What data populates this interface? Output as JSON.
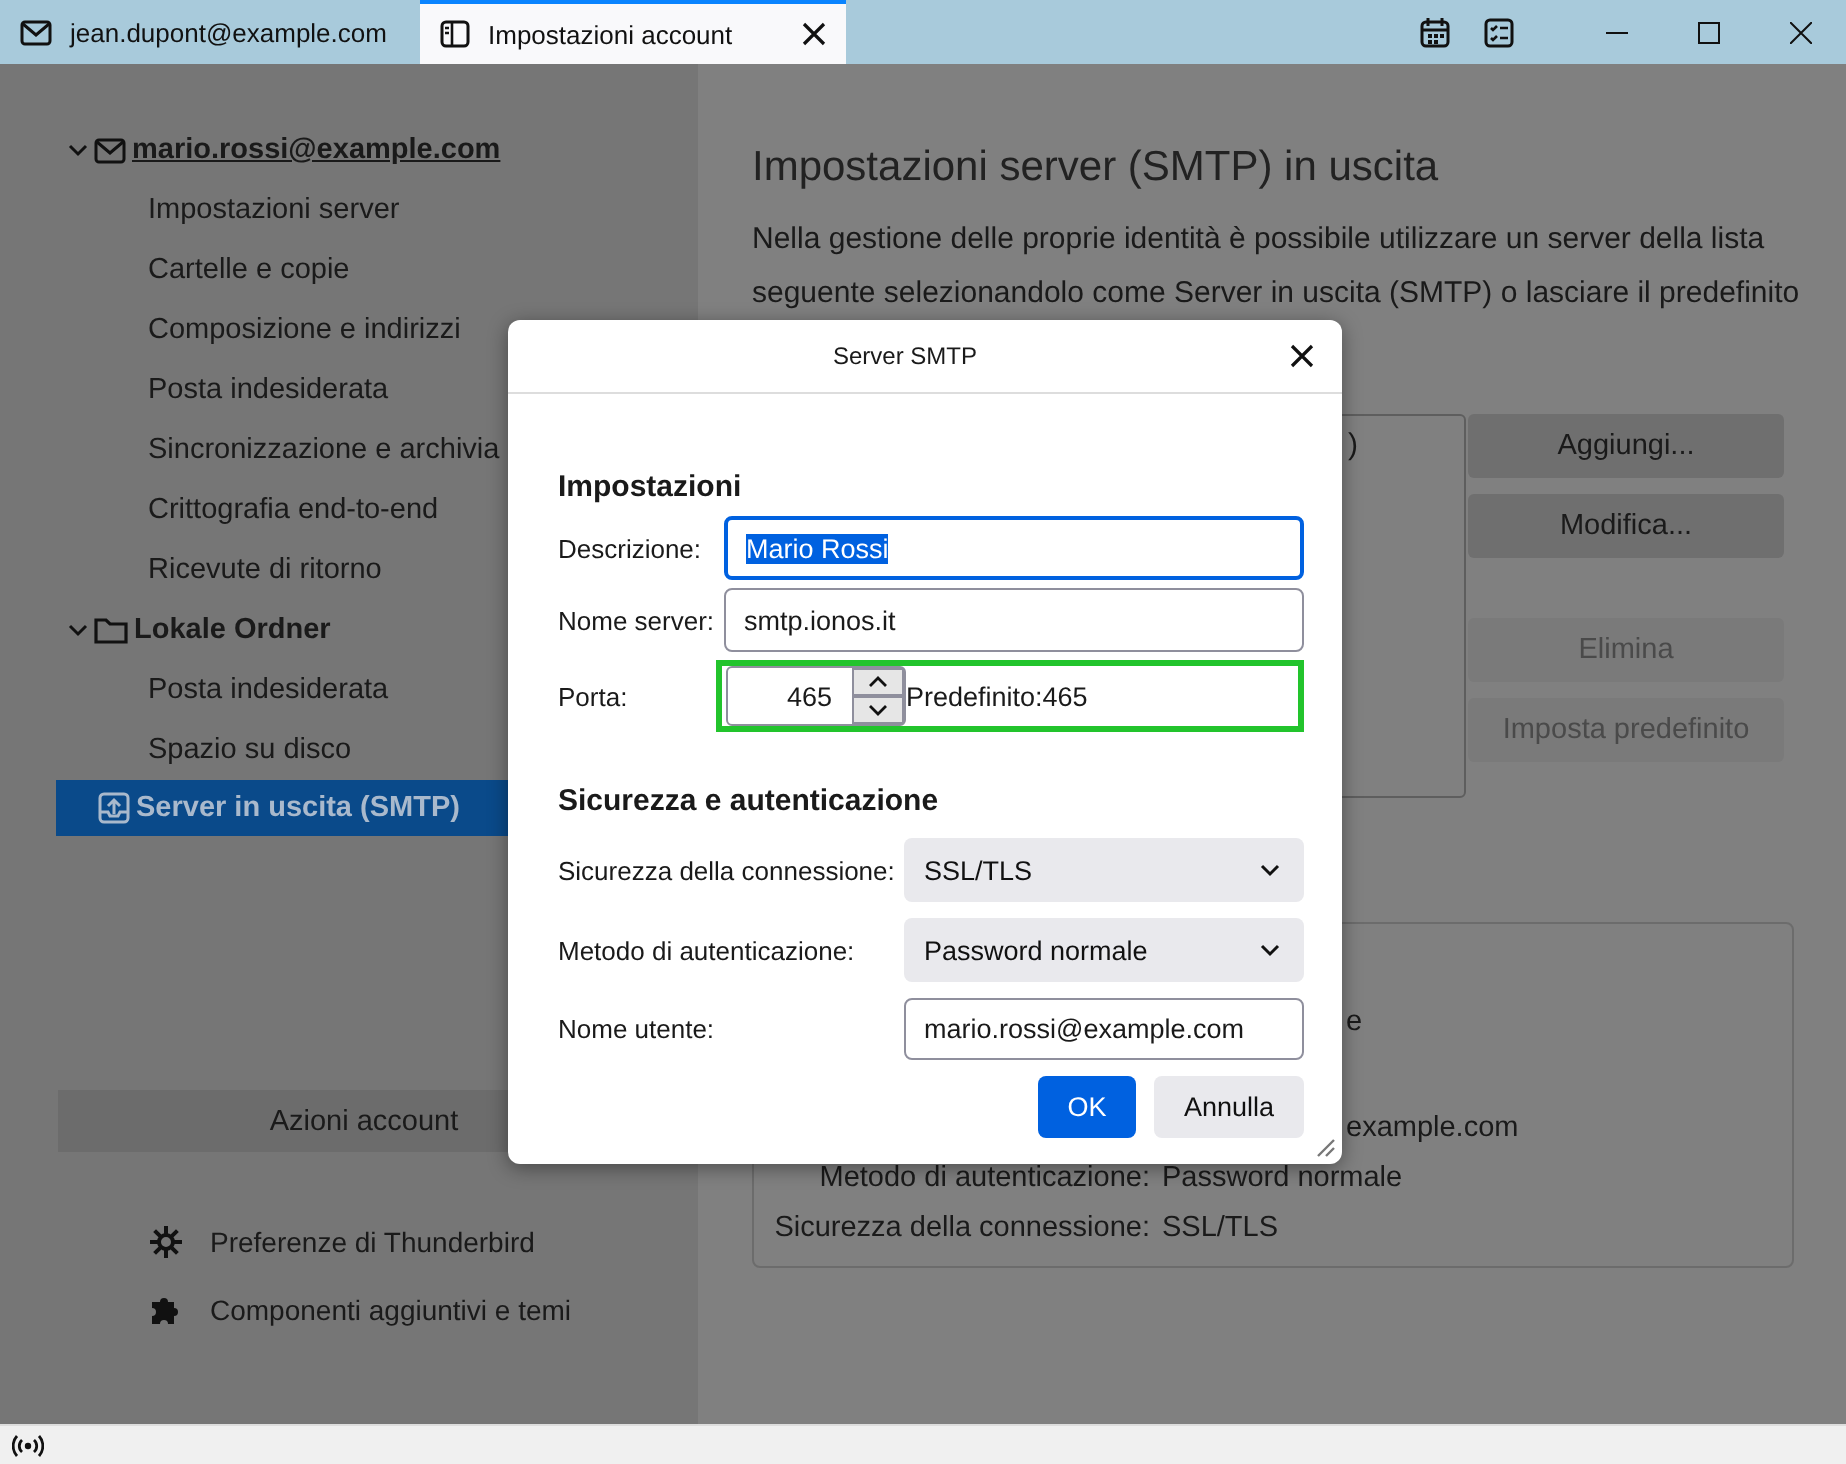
{
  "tabs": [
    {
      "label": "jean.dupont@example.com",
      "selected": false
    },
    {
      "label": "Impostazioni account",
      "selected": true
    }
  ],
  "sidebar": {
    "tree": [
      {
        "label": "mario.rossi@example.com",
        "default": true,
        "expanded": true,
        "selected": false,
        "children": [
          {
            "label": "Impostazioni server",
            "selected": false
          },
          {
            "label": "Cartelle e copie",
            "selected": false
          },
          {
            "label": "Composizione e indirizzi",
            "selected": false
          },
          {
            "label": "Posta indesiderata",
            "selected": false
          },
          {
            "label": "Sincronizzazione e archivia",
            "selected": false
          },
          {
            "label": "Crittografia end-to-end",
            "selected": false
          },
          {
            "label": "Ricevute di ritorno",
            "selected": false
          }
        ]
      },
      {
        "label": "Lokale Ordner",
        "default": false,
        "expanded": true,
        "selected": false,
        "children": [
          {
            "label": "Posta indesiderata",
            "selected": false
          },
          {
            "label": "Spazio su disco",
            "selected": false
          }
        ]
      },
      {
        "label": "Server in uscita (SMTP)",
        "default": false,
        "selected": true
      }
    ],
    "account_actions": "Azioni account",
    "links": [
      {
        "label": "Preferenze di Thunderbird"
      },
      {
        "label": "Componenti aggiuntivi e temi"
      }
    ]
  },
  "main": {
    "title": "Impostazioni server (SMTP) in uscita",
    "description": "Nella gestione delle proprie identità è possibile utilizzare un server della lista seguente selezionandolo come Server in uscita (SMTP) o lasciare il predefinito",
    "server_list": {
      "items": [
        ")"
      ]
    },
    "buttons": [
      {
        "label": "Aggiungi...",
        "disabled": false
      },
      {
        "label": "Modifica...",
        "disabled": false
      },
      {
        "label": "Elimina",
        "disabled": true
      },
      {
        "label": "Imposta predefinito",
        "disabled": true
      }
    ],
    "details": {
      "fragments": [
        "e",
        "example.com"
      ],
      "rows": [
        {
          "label": "Metodo di autenticazione:",
          "value": "Password normale"
        },
        {
          "label": "Sicurezza della connessione:",
          "value": "SSL/TLS"
        }
      ]
    }
  },
  "dialog": {
    "title": "Server SMTP",
    "settings": {
      "heading": "Impostazioni",
      "description": {
        "label": "Descrizione:",
        "value": "Mario Rossi",
        "focused": true
      },
      "server": {
        "label": "Nome server:",
        "value": "smtp.ionos.it"
      },
      "port": {
        "label": "Porta:",
        "value": "465",
        "default_text": "Predefinito:465",
        "highlighted": true
      }
    },
    "security": {
      "heading": "Sicurezza e autenticazione",
      "rows": [
        {
          "kind": "select",
          "label": "Sicurezza della connessione:",
          "value": "SSL/TLS"
        },
        {
          "kind": "select",
          "label": "Metodo di autenticazione:",
          "value": "Password normale"
        },
        {
          "kind": "input",
          "label": "Nome utente:",
          "value": "mario.rossi@example.com"
        }
      ]
    },
    "buttons": [
      {
        "label": "OK",
        "primary": true
      },
      {
        "label": "Annulla",
        "primary": false
      }
    ]
  }
}
